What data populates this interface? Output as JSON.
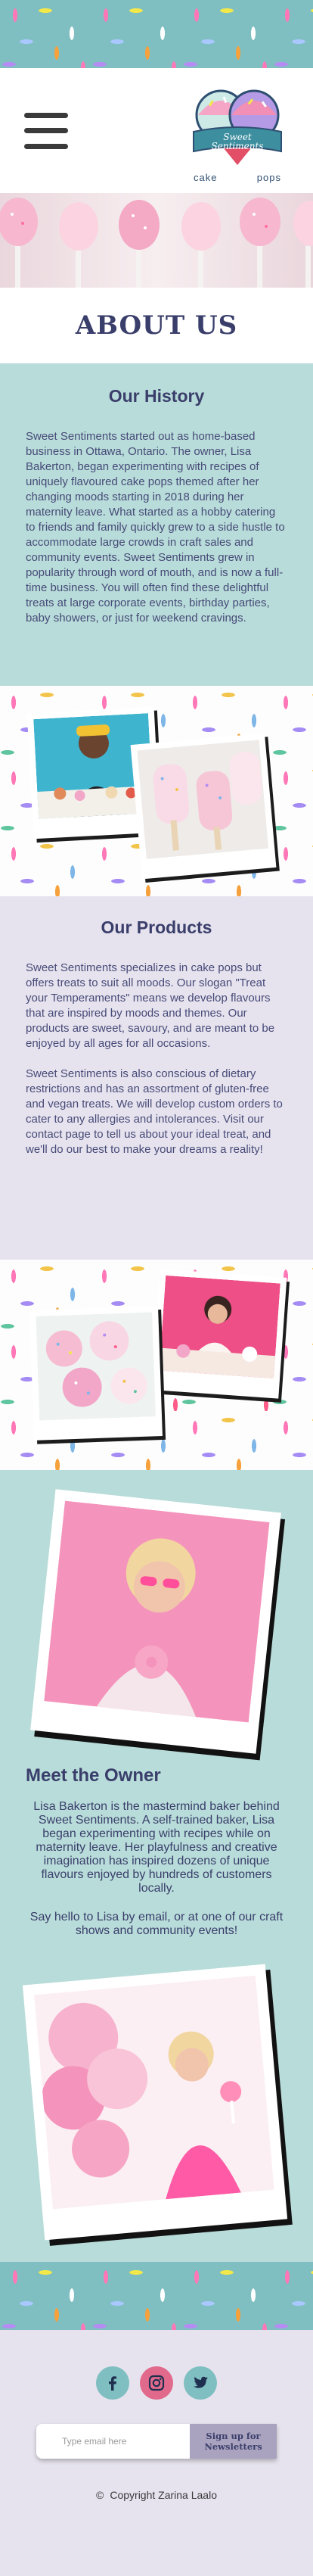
{
  "header": {
    "logo": {
      "script_line1": "Sweet",
      "script_line2": "Sentiments",
      "word_left": "cake",
      "word_right": "pops"
    },
    "menu_icon": "hamburger-menu-icon"
  },
  "page_title": "ABOUT US",
  "history": {
    "heading": "Our History",
    "body": "Sweet Sentiments started out as home-based business in Ottawa, Ontario. The owner, Lisa Bakerton, began experimenting with recipes of uniquely flavoured cake pops themed after her changing moods starting in 2018 during her maternity leave. What started as a hobby catering to friends and family quickly grew to a side hustle to accommodate large crowds in craft sales and community events. Sweet Sentiments grew in popularity through word of mouth, and is now a full-time business. You will often find these delightful treats at large corporate events, birthday parties, baby showers, or just for weekend cravings."
  },
  "products": {
    "heading": "Our Products",
    "paragraphs": [
      "Sweet Sentiments specializes in cake pops but offers treats to suit all moods. Our slogan \"Treat your Temperaments\" means we develop flavours that are inspired by moods and themes. Our products are sweet, savoury, and are meant to be enjoyed by all ages for all occasions.",
      "Sweet Sentiments is also conscious of dietary restrictions and has an assortment of gluten-free and vegan treats. We will develop custom orders to cater to any allergies and intolerances. Visit our contact page to tell us about your ideal treat, and we'll do our best to make your dreams a reality!"
    ]
  },
  "owner": {
    "heading": "Meet the Owner",
    "paragraphs": [
      "Lisa Bakerton is the mastermind baker behind Sweet Sentiments. A self-trained baker, Lisa began experimenting with recipes while on maternity leave. Her playfulness and creative imagination has inspired dozens of unique flavours enjoyed by hundreds of customers locally.",
      "Say hello to Lisa by email, or at one of our craft shows and community events!"
    ]
  },
  "footer": {
    "socials": [
      {
        "name": "facebook-icon",
        "label": "f"
      },
      {
        "name": "instagram-icon",
        "label": "ig"
      },
      {
        "name": "twitter-icon",
        "label": "tw"
      }
    ],
    "newsletter": {
      "placeholder": "Type email here",
      "button_label": "Sign up for Newsletters"
    },
    "copyright_symbol": "©",
    "copyright_text": "Copyright Zarina Laalo"
  },
  "colors": {
    "teal": "#80bfc1",
    "mint": "#b8dcd9",
    "lavender": "#e6e3ee",
    "navy_text": "#3a3e6b",
    "pink": "#f2a6c8"
  }
}
